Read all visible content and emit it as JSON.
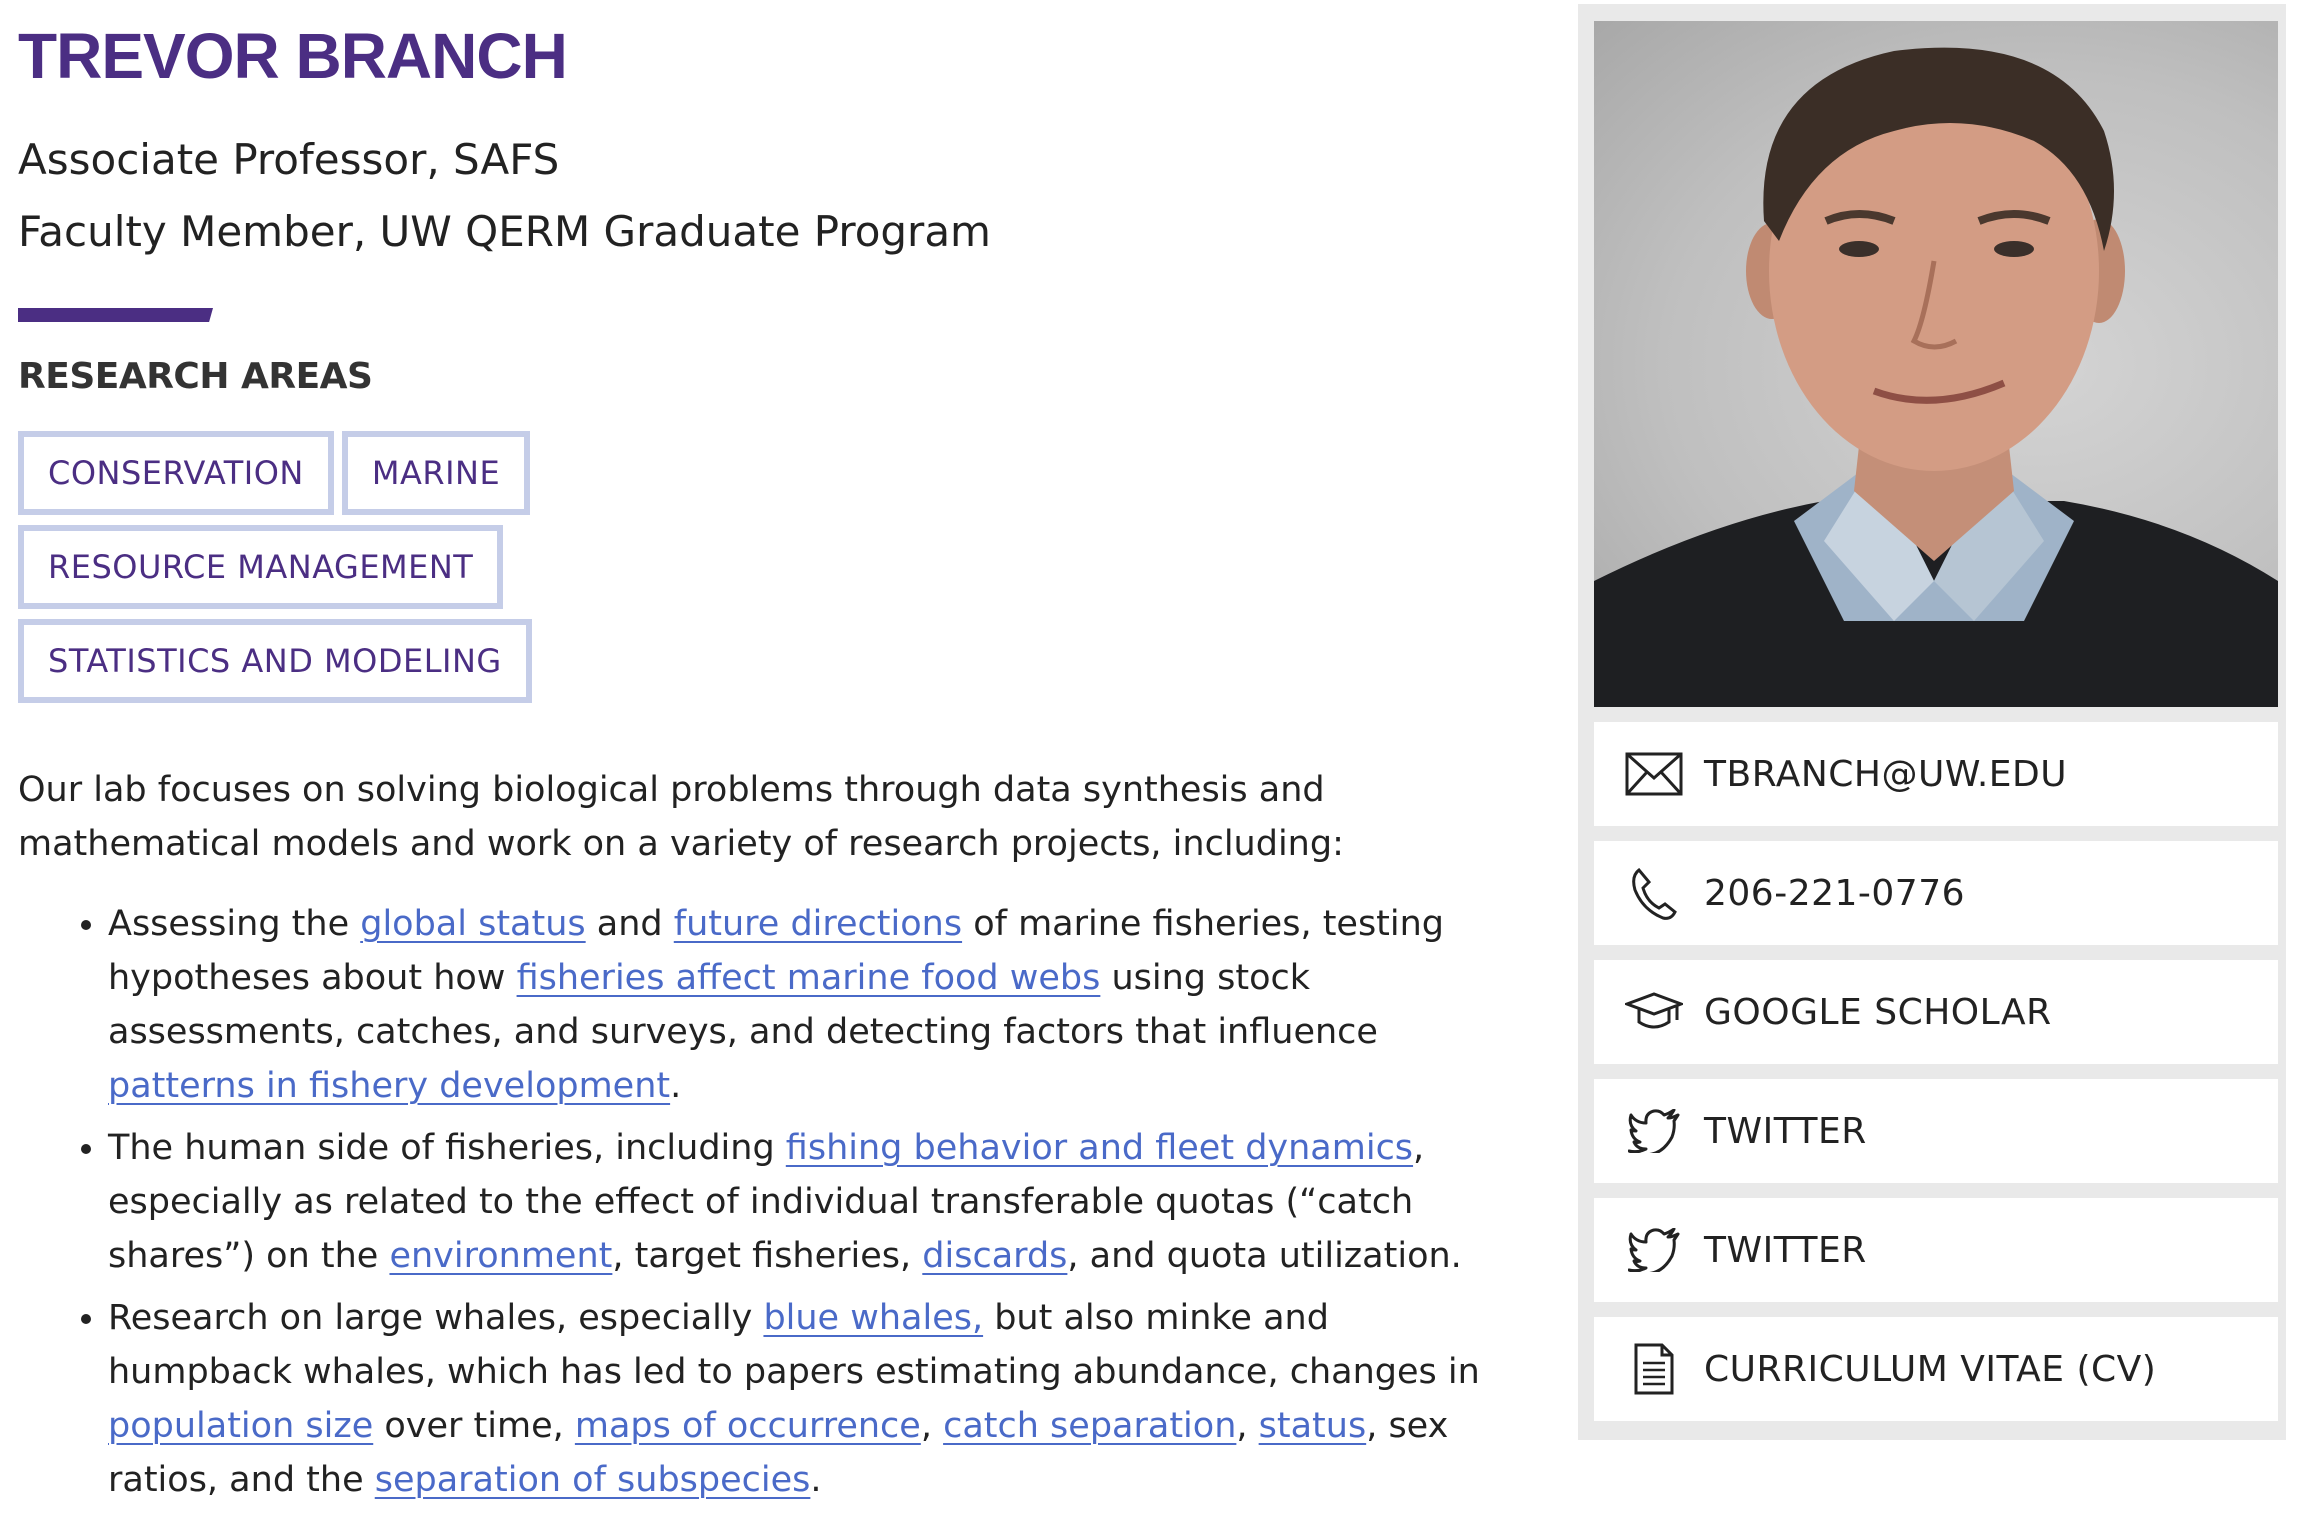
{
  "profile": {
    "name": "TREVOR BRANCH",
    "title_1": "Associate Professor, SAFS",
    "title_2": "Faculty Member, UW QERM Graduate Program"
  },
  "research": {
    "heading": "RESEARCH AREAS",
    "tags": [
      "CONSERVATION",
      "MARINE",
      "RESOURCE MANAGEMENT",
      "STATISTICS AND MODELING"
    ]
  },
  "intro": "Our lab focuses on solving biological problems through data synthesis and mathematical models and work on a variety of research projects, including:",
  "projects": {
    "p1": {
      "t1": "Assessing the ",
      "l1": "global status",
      "t2": " and ",
      "l2": "future directions",
      "t3": " of marine fisheries, testing hypotheses about how ",
      "l3": "fisheries affect marine food webs",
      "t4": " using stock assessments, catches, and surveys, and detecting factors that influence ",
      "l4": "patterns in fishery development",
      "t5": "."
    },
    "p2": {
      "t1": "The human side of fisheries, including ",
      "l1": "fishing behavior and fleet dynamics",
      "t2": ", especially as related to the effect of individual transferable quotas (“catch shares”) on the ",
      "l2": "environment",
      "t3": ", target fisheries, ",
      "l3": "discards",
      "t4": ", and quota utilization."
    },
    "p3": {
      "t1": "Research on large whales, especially ",
      "l1": "blue whales,",
      "t2": " but also minke and humpback whales, which has led to papers estimating abundance, changes in ",
      "l2": "population size",
      "t3": " over time, ",
      "l3": "maps of occurrence",
      "t4": ", ",
      "l4": "catch separation",
      "t5": ", ",
      "l5": "status",
      "t6": ", sex ratios, and the ",
      "l6": "separation of subspecies",
      "t7": "."
    }
  },
  "contact": {
    "email": "TBRANCH@UW.EDU",
    "phone": "206-221-0776",
    "scholar": "GOOGLE SCHOLAR",
    "twitter_1": "TWITTER",
    "twitter_2": "TWITTER",
    "cv": "CURRICULUM VITAE (CV)"
  },
  "colors": {
    "brand_purple": "#4b2e83",
    "tag_border": "#c5cde8",
    "link": "#4a6ac8",
    "sidebar_bg": "#e9e9e9"
  },
  "icons": [
    "envelope-icon",
    "phone-icon",
    "graduation-cap-icon",
    "twitter-bird-icon",
    "document-icon"
  ]
}
